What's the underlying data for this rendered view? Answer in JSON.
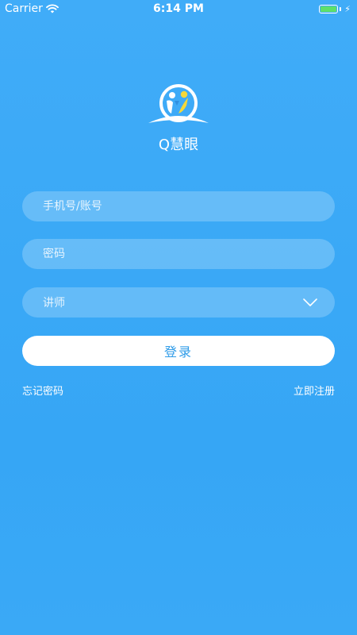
{
  "status_bar": {
    "carrier": "Carrier",
    "time": "6:14 PM",
    "battery_level": 1.0,
    "battery_color": "#5ee06a",
    "wifi_icon": "wifi-icon",
    "charging_icon": "bolt-icon"
  },
  "app": {
    "name": "Q慧眼",
    "logo_icon": "q-huiyan-logo"
  },
  "form": {
    "account_placeholder": "手机号/账号",
    "password_placeholder": "密码",
    "role_selected": "讲师",
    "role_icon": "chevron-down-icon",
    "login_label": "登录",
    "forgot_label": "忘记密码",
    "register_label": "立即注册"
  },
  "colors": {
    "background": "#3aa8f5",
    "button_text": "#2e9be8",
    "logo_yellow": "#f4d83a",
    "logo_blue": "#2f8fe0"
  }
}
